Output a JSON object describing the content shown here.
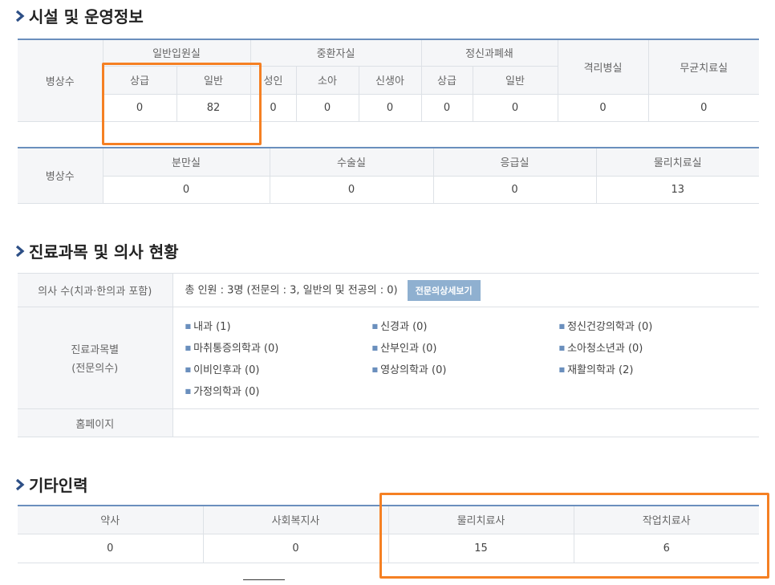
{
  "sections": {
    "facilities_title": "시설 및 운영정보",
    "doctors_title": "진료과목 및 의사 현황",
    "staff_title": "기타인력"
  },
  "beds_table": {
    "row_label": "병상수",
    "groups": [
      "일반입원실",
      "중환자실",
      "정신과폐쇄"
    ],
    "single_headers": [
      "격리병실",
      "무균치료실"
    ],
    "sub_headers": [
      "상급",
      "일반",
      "성인",
      "소아",
      "신생아",
      "상급",
      "일반"
    ],
    "values": [
      "0",
      "82",
      "0",
      "0",
      "0",
      "0",
      "0",
      "0",
      "0"
    ]
  },
  "rooms_table": {
    "row_label": "병상수",
    "headers": [
      "분만실",
      "수술실",
      "응급실",
      "물리치료실"
    ],
    "values": [
      "0",
      "0",
      "0",
      "13"
    ]
  },
  "doctors": {
    "count_label": "의사 수(치과·한의과 포함)",
    "count_value": "총 인원 : 3명 (전문의 : 3, 일반의 및 전공의 : 0)",
    "detail_button": "전문의상세보기",
    "specialty_label_line1": "진료과목별",
    "specialty_label_line2": "(전문의수)",
    "specialties": [
      "내과 (1)",
      "신경과 (0)",
      "정신건강의학과 (0)",
      "마취통증의학과 (0)",
      "산부인과 (0)",
      "소아청소년과 (0)",
      "이비인후과 (0)",
      "영상의학과 (0)",
      "재활의학과 (2)",
      "가정의학과 (0)"
    ],
    "homepage_label": "홈페이지",
    "homepage_value": ""
  },
  "staff_table": {
    "headers": [
      "약사",
      "사회복지사",
      "물리치료사",
      "작업치료사"
    ],
    "values": [
      "0",
      "0",
      "15",
      "6"
    ]
  },
  "colors": {
    "accent_border": "#6a8fbd",
    "highlight": "#f58023",
    "button_bg": "#8fb0d0",
    "header_bg": "#f5f6f8"
  }
}
